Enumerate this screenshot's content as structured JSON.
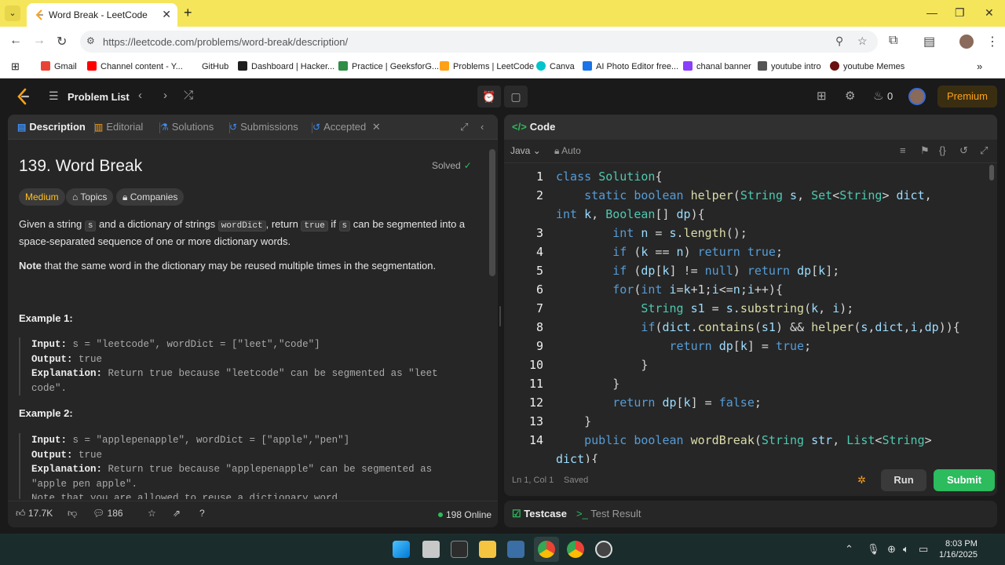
{
  "browser": {
    "tab_title": "Word Break - LeetCode",
    "tab_close": "✕",
    "new_tab": "+",
    "url": "https://leetcode.com/problems/word-break/description/",
    "bookmarks": [
      {
        "label": "Gmail",
        "color": "#ea4335"
      },
      {
        "label": "Channel content - Y...",
        "color": "#ff0000"
      },
      {
        "label": "GitHub",
        "color": "#ffffff"
      },
      {
        "label": "Dashboard | Hacker...",
        "color": "#1ba94c"
      },
      {
        "label": "Practice | GeeksforG...",
        "color": "#2f8d46"
      },
      {
        "label": "Problems | LeetCode",
        "color": "#ffa116"
      },
      {
        "label": "Canva",
        "color": "#00c4cc"
      },
      {
        "label": "AI Photo Editor free...",
        "color": "#1a73e8"
      },
      {
        "label": "chanal banner",
        "color": "#8a3ffc"
      },
      {
        "label": "youtube intro",
        "color": "#333333"
      },
      {
        "label": "youtube Memes",
        "color": "#222222"
      }
    ],
    "more_bookmarks": "»"
  },
  "lc": {
    "problem_list": "Problem List",
    "premium": "Premium",
    "streak": "0"
  },
  "left": {
    "tabs": [
      "Description",
      "Editorial",
      "Solutions",
      "Submissions",
      "Accepted"
    ],
    "title": "139. Word Break",
    "solved": "Solved",
    "chips": [
      "Medium",
      "Topics",
      "Companies"
    ],
    "desc": {
      "p1_a": "Given a string ",
      "p1_s": "s",
      "p1_b": " and a dictionary of strings ",
      "p1_wd": "wordDict",
      "p1_c": ", return ",
      "p1_true": "true",
      "p1_d": " if ",
      "p1_s2": "s",
      "p1_e": " can be segmented into a space-separated sequence of one or more dictionary words.",
      "note_bold": "Note",
      "note_rest": " that the same word in the dictionary may be reused multiple times in the segmentation."
    },
    "examples": [
      {
        "title": "Example 1:",
        "input_label": "Input:",
        "input": " s = \"leetcode\", wordDict = [\"leet\",\"code\"]",
        "output_label": "Output:",
        "output": " true",
        "expl_label": "Explanation:",
        "expl": " Return true because \"leetcode\" can be segmented as \"leet code\"."
      },
      {
        "title": "Example 2:",
        "input_label": "Input:",
        "input": " s = \"applepenapple\", wordDict = [\"apple\",\"pen\"]",
        "output_label": "Output:",
        "output": " true",
        "expl_label": "Explanation:",
        "expl": " Return true because \"applepenapple\" can be segmented as \"apple pen apple\".",
        "note": "Note that you are allowed to reuse a dictionary word."
      }
    ],
    "likes": "17.7K",
    "comments": "186",
    "online": "198 Online"
  },
  "right": {
    "code_label": "Code",
    "lang": "Java",
    "auto": "Auto",
    "status": "Ln 1, Col 1",
    "saved": "Saved",
    "run": "Run",
    "submit": "Submit",
    "testcase": "Testcase",
    "test_result": "Test Result"
  },
  "taskbar": {
    "time": "8:03 PM",
    "date": "1/16/2025"
  }
}
